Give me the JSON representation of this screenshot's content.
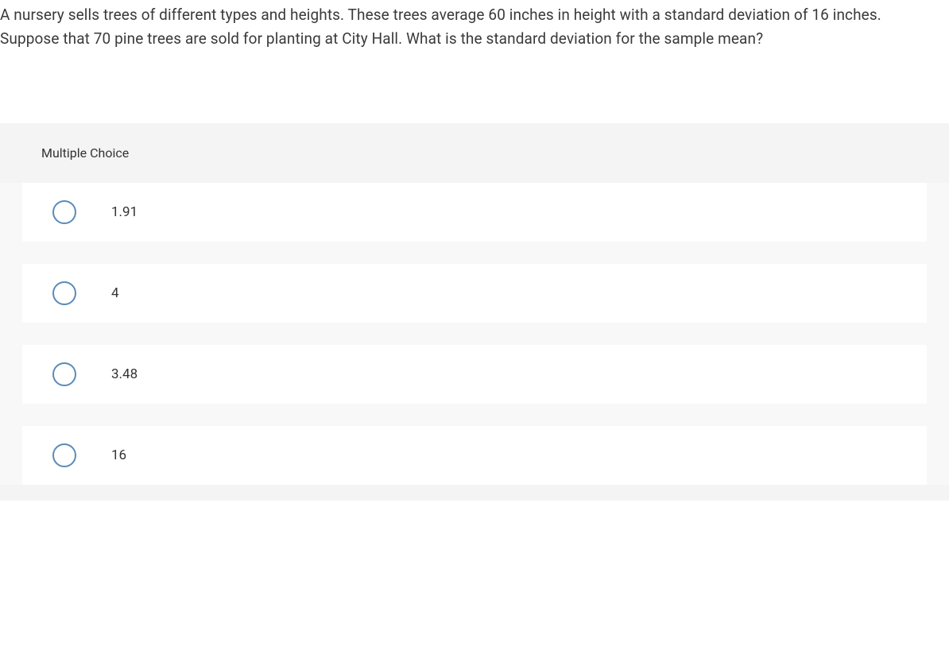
{
  "question": "A nursery sells trees of different types and heights. These trees average 60 inches in height with a standard deviation of 16 inches. Suppose that 70 pine trees are sold for planting at City Hall. What is the standard deviation for the sample mean?",
  "section_title": "Multiple Choice",
  "options": [
    {
      "label": "1.91"
    },
    {
      "label": "4"
    },
    {
      "label": "3.48"
    },
    {
      "label": "16"
    }
  ]
}
